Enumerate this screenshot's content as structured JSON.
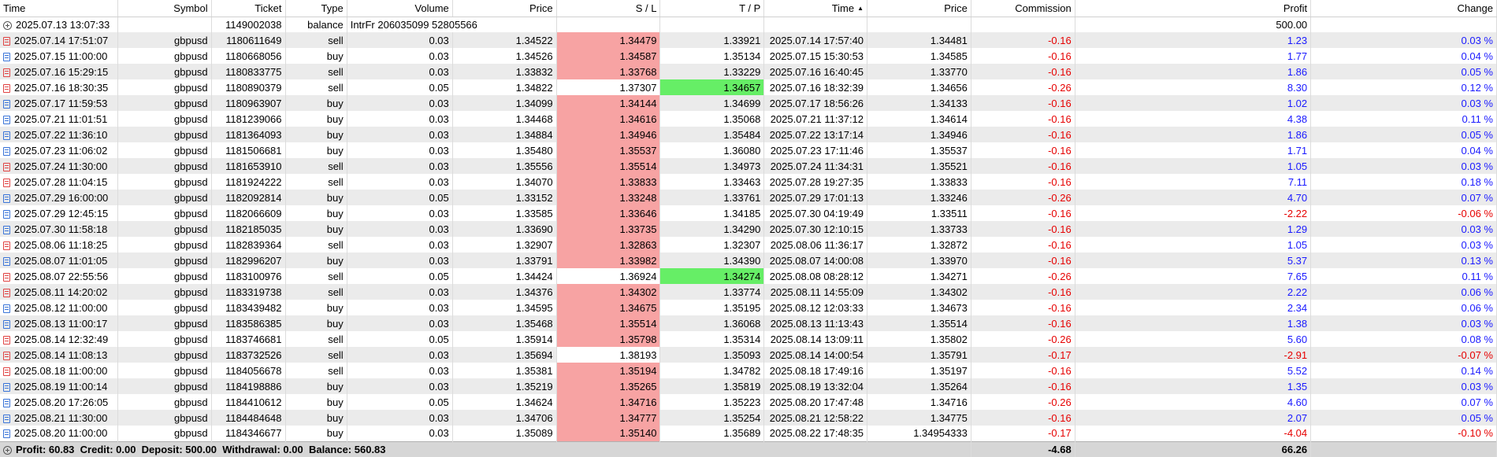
{
  "columns": {
    "time": "Time",
    "symbol": "Symbol",
    "ticket": "Ticket",
    "type": "Type",
    "volume": "Volume",
    "price_open": "Price",
    "sl": "S / L",
    "tp": "T / P",
    "time_close": "Time",
    "price_close": "Price",
    "commission": "Commission",
    "profit": "Profit",
    "change": "Change"
  },
  "sort_indicator": "▲",
  "colors": {
    "sl_highlight": "#f7a3a3",
    "tp_highlight": "#66ee66",
    "negative": "#e60000",
    "positive": "#1a1aff",
    "alt_row": "#ebebeb"
  },
  "balance_row": {
    "time": "2025.07.13 13:07:33",
    "ticket": "1149002038",
    "type": "balance",
    "comment": "IntrFr 206035099 52805566",
    "profit": "500.00"
  },
  "trades": [
    {
      "time": "2025.07.14 17:51:07",
      "symbol": "gbpusd",
      "ticket": "1180611649",
      "type": "sell",
      "volume": "0.03",
      "price_open": "1.34522",
      "sl": "1.34479",
      "tp": "1.33921",
      "time_close": "2025.07.14 17:57:40",
      "price_close": "1.34481",
      "commission": "-0.16",
      "profit": "1.23",
      "change": "0.03 %",
      "hit": "sl"
    },
    {
      "time": "2025.07.15 11:00:00",
      "symbol": "gbpusd",
      "ticket": "1180668056",
      "type": "buy",
      "volume": "0.03",
      "price_open": "1.34526",
      "sl": "1.34587",
      "tp": "1.35134",
      "time_close": "2025.07.15 15:30:53",
      "price_close": "1.34585",
      "commission": "-0.16",
      "profit": "1.77",
      "change": "0.04 %",
      "hit": "sl"
    },
    {
      "time": "2025.07.16 15:29:15",
      "symbol": "gbpusd",
      "ticket": "1180833775",
      "type": "sell",
      "volume": "0.03",
      "price_open": "1.33832",
      "sl": "1.33768",
      "tp": "1.33229",
      "time_close": "2025.07.16 16:40:45",
      "price_close": "1.33770",
      "commission": "-0.16",
      "profit": "1.86",
      "change": "0.05 %",
      "hit": "sl"
    },
    {
      "time": "2025.07.16 18:30:35",
      "symbol": "gbpusd",
      "ticket": "1180890379",
      "type": "sell",
      "volume": "0.05",
      "price_open": "1.34822",
      "sl": "1.37307",
      "tp": "1.34657",
      "time_close": "2025.07.16 18:32:39",
      "price_close": "1.34656",
      "commission": "-0.26",
      "profit": "8.30",
      "change": "0.12 %",
      "hit": "tp"
    },
    {
      "time": "2025.07.17 11:59:53",
      "symbol": "gbpusd",
      "ticket": "1180963907",
      "type": "buy",
      "volume": "0.03",
      "price_open": "1.34099",
      "sl": "1.34144",
      "tp": "1.34699",
      "time_close": "2025.07.17 18:56:26",
      "price_close": "1.34133",
      "commission": "-0.16",
      "profit": "1.02",
      "change": "0.03 %",
      "hit": "sl"
    },
    {
      "time": "2025.07.21 11:01:51",
      "symbol": "gbpusd",
      "ticket": "1181239066",
      "type": "buy",
      "volume": "0.03",
      "price_open": "1.34468",
      "sl": "1.34616",
      "tp": "1.35068",
      "time_close": "2025.07.21 11:37:12",
      "price_close": "1.34614",
      "commission": "-0.16",
      "profit": "4.38",
      "change": "0.11 %",
      "hit": "sl"
    },
    {
      "time": "2025.07.22 11:36:10",
      "symbol": "gbpusd",
      "ticket": "1181364093",
      "type": "buy",
      "volume": "0.03",
      "price_open": "1.34884",
      "sl": "1.34946",
      "tp": "1.35484",
      "time_close": "2025.07.22 13:17:14",
      "price_close": "1.34946",
      "commission": "-0.16",
      "profit": "1.86",
      "change": "0.05 %",
      "hit": "sl"
    },
    {
      "time": "2025.07.23 11:06:02",
      "symbol": "gbpusd",
      "ticket": "1181506681",
      "type": "buy",
      "volume": "0.03",
      "price_open": "1.35480",
      "sl": "1.35537",
      "tp": "1.36080",
      "time_close": "2025.07.23 17:11:46",
      "price_close": "1.35537",
      "commission": "-0.16",
      "profit": "1.71",
      "change": "0.04 %",
      "hit": "sl"
    },
    {
      "time": "2025.07.24 11:30:00",
      "symbol": "gbpusd",
      "ticket": "1181653910",
      "type": "sell",
      "volume": "0.03",
      "price_open": "1.35556",
      "sl": "1.35514",
      "tp": "1.34973",
      "time_close": "2025.07.24 11:34:31",
      "price_close": "1.35521",
      "commission": "-0.16",
      "profit": "1.05",
      "change": "0.03 %",
      "hit": "sl"
    },
    {
      "time": "2025.07.28 11:04:15",
      "symbol": "gbpusd",
      "ticket": "1181924222",
      "type": "sell",
      "volume": "0.03",
      "price_open": "1.34070",
      "sl": "1.33833",
      "tp": "1.33463",
      "time_close": "2025.07.28 19:27:35",
      "price_close": "1.33833",
      "commission": "-0.16",
      "profit": "7.11",
      "change": "0.18 %",
      "hit": "sl"
    },
    {
      "time": "2025.07.29 16:00:00",
      "symbol": "gbpusd",
      "ticket": "1182092814",
      "type": "buy",
      "volume": "0.05",
      "price_open": "1.33152",
      "sl": "1.33248",
      "tp": "1.33761",
      "time_close": "2025.07.29 17:01:13",
      "price_close": "1.33246",
      "commission": "-0.26",
      "profit": "4.70",
      "change": "0.07 %",
      "hit": "sl"
    },
    {
      "time": "2025.07.29 12:45:15",
      "symbol": "gbpusd",
      "ticket": "1182066609",
      "type": "buy",
      "volume": "0.03",
      "price_open": "1.33585",
      "sl": "1.33646",
      "tp": "1.34185",
      "time_close": "2025.07.30 04:19:49",
      "price_close": "1.33511",
      "commission": "-0.16",
      "profit": "-2.22",
      "change": "-0.06 %",
      "hit": "sl"
    },
    {
      "time": "2025.07.30 11:58:18",
      "symbol": "gbpusd",
      "ticket": "1182185035",
      "type": "buy",
      "volume": "0.03",
      "price_open": "1.33690",
      "sl": "1.33735",
      "tp": "1.34290",
      "time_close": "2025.07.30 12:10:15",
      "price_close": "1.33733",
      "commission": "-0.16",
      "profit": "1.29",
      "change": "0.03 %",
      "hit": "sl"
    },
    {
      "time": "2025.08.06 11:18:25",
      "symbol": "gbpusd",
      "ticket": "1182839364",
      "type": "sell",
      "volume": "0.03",
      "price_open": "1.32907",
      "sl": "1.32863",
      "tp": "1.32307",
      "time_close": "2025.08.06 11:36:17",
      "price_close": "1.32872",
      "commission": "-0.16",
      "profit": "1.05",
      "change": "0.03 %",
      "hit": "sl"
    },
    {
      "time": "2025.08.07 11:01:05",
      "symbol": "gbpusd",
      "ticket": "1182996207",
      "type": "buy",
      "volume": "0.03",
      "price_open": "1.33791",
      "sl": "1.33982",
      "tp": "1.34390",
      "time_close": "2025.08.07 14:00:08",
      "price_close": "1.33970",
      "commission": "-0.16",
      "profit": "5.37",
      "change": "0.13 %",
      "hit": "sl"
    },
    {
      "time": "2025.08.07 22:55:56",
      "symbol": "gbpusd",
      "ticket": "1183100976",
      "type": "sell",
      "volume": "0.05",
      "price_open": "1.34424",
      "sl": "1.36924",
      "tp": "1.34274",
      "time_close": "2025.08.08 08:28:12",
      "price_close": "1.34271",
      "commission": "-0.26",
      "profit": "7.65",
      "change": "0.11 %",
      "hit": "tp"
    },
    {
      "time": "2025.08.11 14:20:02",
      "symbol": "gbpusd",
      "ticket": "1183319738",
      "type": "sell",
      "volume": "0.03",
      "price_open": "1.34376",
      "sl": "1.34302",
      "tp": "1.33774",
      "time_close": "2025.08.11 14:55:09",
      "price_close": "1.34302",
      "commission": "-0.16",
      "profit": "2.22",
      "change": "0.06 %",
      "hit": "sl"
    },
    {
      "time": "2025.08.12 11:00:00",
      "symbol": "gbpusd",
      "ticket": "1183439482",
      "type": "buy",
      "volume": "0.03",
      "price_open": "1.34595",
      "sl": "1.34675",
      "tp": "1.35195",
      "time_close": "2025.08.12 12:03:33",
      "price_close": "1.34673",
      "commission": "-0.16",
      "profit": "2.34",
      "change": "0.06 %",
      "hit": "sl"
    },
    {
      "time": "2025.08.13 11:00:17",
      "symbol": "gbpusd",
      "ticket": "1183586385",
      "type": "buy",
      "volume": "0.03",
      "price_open": "1.35468",
      "sl": "1.35514",
      "tp": "1.36068",
      "time_close": "2025.08.13 11:13:43",
      "price_close": "1.35514",
      "commission": "-0.16",
      "profit": "1.38",
      "change": "0.03 %",
      "hit": "sl"
    },
    {
      "time": "2025.08.14 12:32:49",
      "symbol": "gbpusd",
      "ticket": "1183746681",
      "type": "sell",
      "volume": "0.05",
      "price_open": "1.35914",
      "sl": "1.35798",
      "tp": "1.35314",
      "time_close": "2025.08.14 13:09:11",
      "price_close": "1.35802",
      "commission": "-0.26",
      "profit": "5.60",
      "change": "0.08 %",
      "hit": "sl"
    },
    {
      "time": "2025.08.14 11:08:13",
      "symbol": "gbpusd",
      "ticket": "1183732526",
      "type": "sell",
      "volume": "0.03",
      "price_open": "1.35694",
      "sl": "1.38193",
      "tp": "1.35093",
      "time_close": "2025.08.14 14:00:54",
      "price_close": "1.35791",
      "commission": "-0.17",
      "profit": "-2.91",
      "change": "-0.07 %",
      "hit": "none"
    },
    {
      "time": "2025.08.18 11:00:00",
      "symbol": "gbpusd",
      "ticket": "1184056678",
      "type": "sell",
      "volume": "0.03",
      "price_open": "1.35381",
      "sl": "1.35194",
      "tp": "1.34782",
      "time_close": "2025.08.18 17:49:16",
      "price_close": "1.35197",
      "commission": "-0.16",
      "profit": "5.52",
      "change": "0.14 %",
      "hit": "sl"
    },
    {
      "time": "2025.08.19 11:00:14",
      "symbol": "gbpusd",
      "ticket": "1184198886",
      "type": "buy",
      "volume": "0.03",
      "price_open": "1.35219",
      "sl": "1.35265",
      "tp": "1.35819",
      "time_close": "2025.08.19 13:32:04",
      "price_close": "1.35264",
      "commission": "-0.16",
      "profit": "1.35",
      "change": "0.03 %",
      "hit": "sl"
    },
    {
      "time": "2025.08.20 17:26:05",
      "symbol": "gbpusd",
      "ticket": "1184410612",
      "type": "buy",
      "volume": "0.05",
      "price_open": "1.34624",
      "sl": "1.34716",
      "tp": "1.35223",
      "time_close": "2025.08.20 17:47:48",
      "price_close": "1.34716",
      "commission": "-0.26",
      "profit": "4.60",
      "change": "0.07 %",
      "hit": "sl"
    },
    {
      "time": "2025.08.21 11:30:00",
      "symbol": "gbpusd",
      "ticket": "1184484648",
      "type": "buy",
      "volume": "0.03",
      "price_open": "1.34706",
      "sl": "1.34777",
      "tp": "1.35254",
      "time_close": "2025.08.21 12:58:22",
      "price_close": "1.34775",
      "commission": "-0.16",
      "profit": "2.07",
      "change": "0.05 %",
      "hit": "sl"
    },
    {
      "time": "2025.08.20 11:00:00",
      "symbol": "gbpusd",
      "ticket": "1184346677",
      "type": "buy",
      "volume": "0.03",
      "price_open": "1.35089",
      "sl": "1.35140",
      "tp": "1.35689",
      "time_close": "2025.08.22 17:48:35",
      "price_close": "1.34954333",
      "commission": "-0.17",
      "profit": "-4.04",
      "change": "-0.10 %",
      "hit": "sl"
    }
  ],
  "footer": {
    "summary": "Profit: 60.83  Credit: 0.00  Deposit: 500.00  Withdrawal: 0.00  Balance: 560.83",
    "commission_total": "-4.68",
    "profit_total": "66.26"
  }
}
